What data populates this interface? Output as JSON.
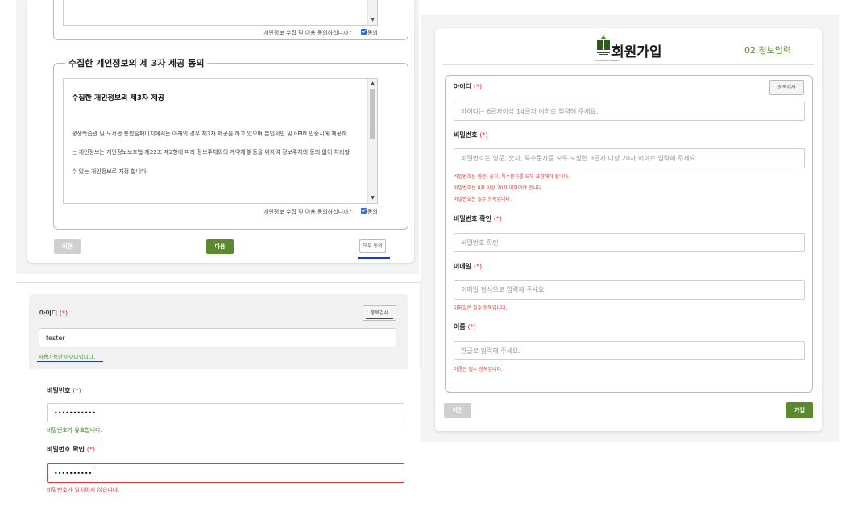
{
  "consent": {
    "agree_question": "개인정보 수집 및 이용 동의하십니까?",
    "agree_label": "동의",
    "third_party_legend": "수집한 개인정보의 제 3자 제공 동의",
    "doc_title": "수집한 개인정보의 제3자 제공",
    "doc_lines": [
      "평생학습관 및 도서관 통합홈페이지에서는 아래의 경우 제3자 제공을 하고 있으며 본인확인 및 I-PIN 인증시에 제공하",
      "는 개인정보는 개인정보보호법 제22조 제2항에 따라 정보주체와의 계약체결 등을 위하여 정보주체의 동의 없이 처리할",
      "수 있는 개인정보로 지정 합니다."
    ],
    "agree_question_2": "개인정보 수집 및 이용 동의하십니까?",
    "agree_label_2": "동의",
    "prev_button": "이전",
    "next_button": "다음",
    "agree_all_button": "모두 동의"
  },
  "signup": {
    "title": "회원가입",
    "logo_caption": "SEONGBUK LIBRARY",
    "step": "02.정보입력",
    "required_mark": "(*)",
    "id_label": "아이디",
    "dup_check_button": "중복검사",
    "id_placeholder": "아이디는 6글자이상 14글자 이하로 입력해 주세요.",
    "pw_label": "비밀번호",
    "pw_placeholder": "비밀번호는 영문, 숫자, 특수문자를 모두 포함한 8글자 이상 20자 이하로 입력해 주세요.",
    "pw_errors": [
      "비밀번호는 영문, 숫자, 특수문자를 모두 포함해야 합니다.",
      "비밀번호는 8자 이상 20자 이하여야 합니다.",
      "비밀번호는 필수 항목입니다."
    ],
    "pw_confirm_label": "비밀번호 확인",
    "pw_confirm_placeholder": "비밀번호 확인",
    "email_label": "이메일",
    "email_placeholder": "이메일 형식으로 입력해 주세요.",
    "email_error": "이메일은 필수 항목입니다.",
    "name_label": "이름",
    "name_placeholder": "한글로 입력해 주세요.",
    "name_error": "이름은 필수 항목입니다.",
    "prev_button": "이전",
    "submit_button": "가입"
  },
  "id_check": {
    "id_label": "아이디",
    "required_mark": "(*)",
    "dup_check_button": "중복검사",
    "id_value": "tester",
    "id_ok_message": "사용가능한 아이디입니다.",
    "pw_label": "비밀번호",
    "pw_value": "•••••••••••",
    "pw_ok_message": "비밀번호가 유효합니다.",
    "pw_confirm_label": "비밀번호 확인",
    "pw_confirm_value": "••••••••••",
    "pw_confirm_error": "비밀번호가 일치하지 않습니다."
  },
  "colors": {
    "accent_green": "#5b8a2e",
    "error_red": "#e03a3a",
    "ok_green": "#3d8a2e",
    "highlight_blue": "#1a3cc7",
    "checkbox_blue": "#2f6fd6"
  }
}
